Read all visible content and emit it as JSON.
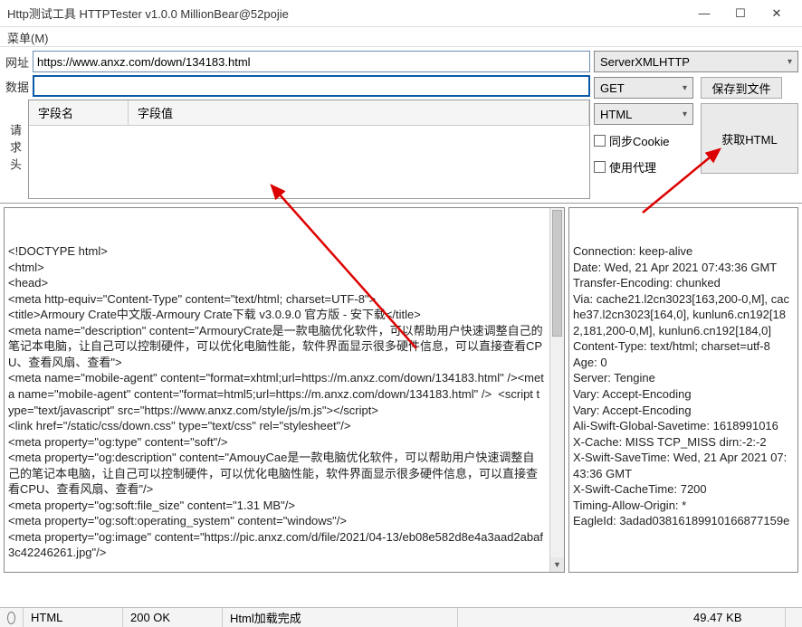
{
  "window": {
    "title": "Http测试工具 HTTPTester v1.0.0    MillionBear@52pojie",
    "min": "—",
    "max": "☐",
    "close": "✕"
  },
  "menu": {
    "label": "菜单(M)"
  },
  "fields": {
    "url_label": "网址",
    "url_value": "https://www.anxz.com/down/134183.html",
    "data_label": "数据",
    "data_value": "",
    "headers_label": "请求头",
    "th_name": "字段名",
    "th_value": "字段值"
  },
  "controls": {
    "engine": "ServerXMLHTTP",
    "method": "GET",
    "format": "HTML",
    "save_btn": "保存到文件",
    "go_btn": "获取HTML",
    "sync_cookie": "同步Cookie",
    "use_proxy": "使用代理"
  },
  "response_body": "<!DOCTYPE html>\n<html>\n<head>\n<meta http-equiv=\"Content-Type\" content=\"text/html; charset=UTF-8\">\n<title>Armoury Crate中文版-Armoury Crate下载 v3.0.9.0 官方版 - 安下载</title>\n<meta name=\"description\" content=\"ArmouryCrate是一款电脑优化软件，可以帮助用户快速调整自己的笔记本电脑，让自己可以控制硬件，可以优化电脑性能，软件界面显示很多硬件信息，可以直接查看CPU、查看风扇、查看\">\n<meta name=\"mobile-agent\" content=\"format=xhtml;url=https://m.anxz.com/down/134183.html\" /><meta name=\"mobile-agent\" content=\"format=html5;url=https://m.anxz.com/down/134183.html\" />  <script type=\"text/javascript\" src=\"https://www.anxz.com/style/js/m.js\"></script>\n<link href=\"/static/css/down.css\" type=\"text/css\" rel=\"stylesheet\"/>\n<meta property=\"og:type\" content=\"soft\"/>\n<meta property=\"og:description\" content=\"AmouyCae是一款电脑优化软件，可以帮助用户快速调整自己的笔记本电脑，让自己可以控制硬件，可以优化电脑性能，软件界面显示很多硬件信息，可以直接查看CPU、查看风扇、查看\"/>\n<meta property=\"og:soft:file_size\" content=\"1.31 MB\"/>\n<meta property=\"og:soft:operating_system\" content=\"windows\"/>\n<meta property=\"og:image\" content=\"https://pic.anxz.com/d/file/2021/04-13/eb08e582d8e4a3aad2abaf3c42246261.jpg\"/>",
  "response_headers": "Connection: keep-alive\nDate: Wed, 21 Apr 2021 07:43:36 GMT\nTransfer-Encoding: chunked\nVia: cache21.l2cn3023[163,200-0,M], cache37.l2cn3023[164,0], kunlun6.cn192[182,181,200-0,M], kunlun6.cn192[184,0]\nContent-Type: text/html; charset=utf-8\nAge: 0\nServer: Tengine\nVary: Accept-Encoding\nVary: Accept-Encoding\nAli-Swift-Global-Savetime: 1618991016\nX-Cache: MISS TCP_MISS dirn:-2:-2\nX-Swift-SaveTime: Wed, 21 Apr 2021 07:43:36 GMT\nX-Swift-CacheTime: 7200\nTiming-Allow-Origin: *\nEagleId: 3adad03816189910166877159e",
  "status": {
    "format": "HTML",
    "code": "200 OK",
    "msg": "Html加载完成",
    "size": "49.47 KB"
  }
}
